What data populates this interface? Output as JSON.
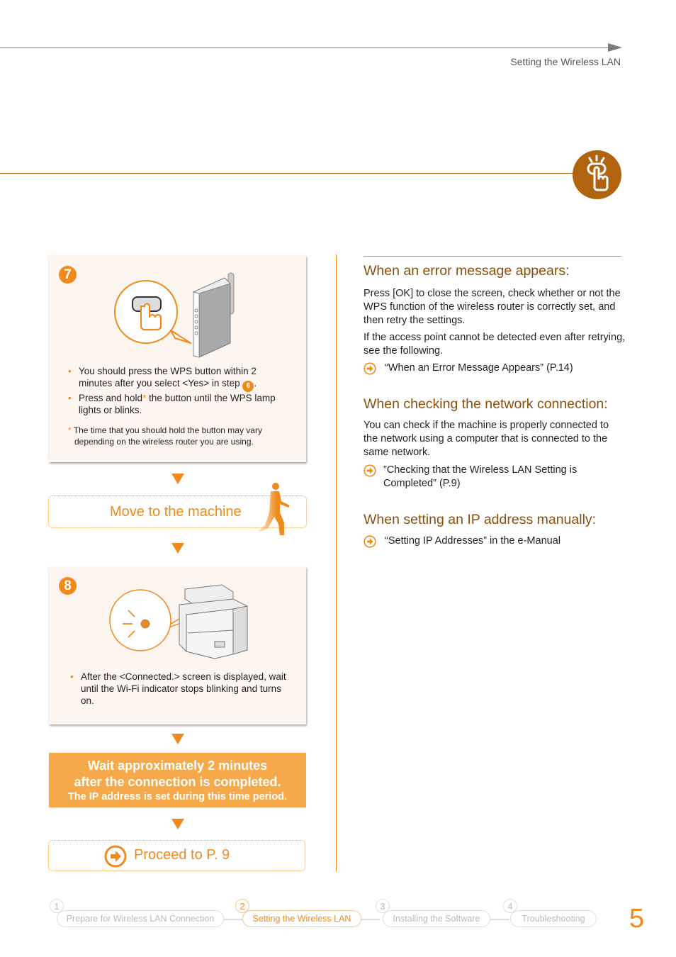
{
  "header": {
    "section_title": "Setting the Wireless LAN"
  },
  "colors": {
    "accent_orange": "#f08a1c",
    "section_brown": "#b0640f",
    "heading_brown": "#8a4f0d",
    "card_bg": "#fdf6f0",
    "wait_box_bg": "#f5a94a"
  },
  "steps": [
    {
      "number": "7",
      "illustration": "finger-pressing-wps-button-on-router",
      "bullets": [
        {
          "text_before": "You should press the WPS button within 2 minutes after you select <Yes> in step ",
          "step_ref": "6",
          "text_after": "."
        },
        {
          "text_before": "Press and hold",
          "asterisk": "*",
          "text_after": " the button until the WPS lamp lights or blinks."
        }
      ],
      "note_marker": "*",
      "note": "The time that you should hold the button may vary depending on the wireless router you are using."
    },
    {
      "number": "8",
      "illustration": "printer-wifi-indicator-blinking",
      "bullets": [
        {
          "text": "After the <Connected.> screen is displayed, wait until the Wi-Fi indicator stops blinking and turns on."
        }
      ]
    }
  ],
  "move_box": {
    "label": "Move to the machine",
    "icon": "walking-person-icon"
  },
  "wait_box": {
    "line1": "Wait approximately 2 minutes",
    "line2": "after the connection is completed.",
    "line3": "The IP address is set during this time period."
  },
  "proceed": {
    "label": "Proceed to P. 9",
    "icon": "arrow-circle-right-icon"
  },
  "right_sections": [
    {
      "heading": "When an error message appears:",
      "paragraphs": [
        "Press [OK] to close the screen, check whether or not the WPS function of the wireless router is correctly set, and then retry the settings.",
        "If the access point cannot be detected even after retrying, see the following."
      ],
      "refs": [
        "“When an Error Message Appears” (P.14)"
      ]
    },
    {
      "heading": "When checking the network connection:",
      "paragraphs": [
        "You can check if the machine is properly connected to the network using a computer that is connected to the same network."
      ],
      "refs": [
        "”Checking that the Wireless LAN Setting is Completed” (P.9)"
      ]
    },
    {
      "heading": "When setting an IP address manually:",
      "paragraphs": [],
      "refs": [
        "“Setting IP Addresses” in the e-Manual"
      ]
    }
  ],
  "footer": {
    "steps": [
      {
        "num": "1",
        "label": "Prepare for Wireless LAN Connection",
        "active": false
      },
      {
        "num": "2",
        "label": "Setting the Wireless LAN",
        "active": true
      },
      {
        "num": "3",
        "label": "Installing the Software",
        "active": false
      },
      {
        "num": "4",
        "label": "Troubleshooting",
        "active": false
      }
    ],
    "page_number": "5"
  }
}
